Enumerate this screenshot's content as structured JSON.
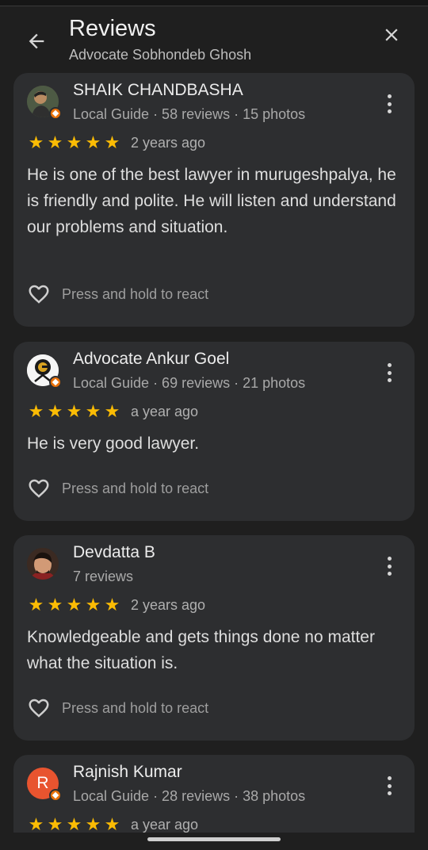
{
  "header": {
    "title": "Reviews",
    "subtitle": "Advocate Sobhondeb Ghosh",
    "back_icon": "arrow-back-icon",
    "close_icon": "close-icon"
  },
  "colors": {
    "star": "#fbbc04",
    "badge": "#e8710a",
    "card": "#2d2e30",
    "background": "#1f1f1f"
  },
  "reviews": [
    {
      "name": "SHAIK CHANDBASHA",
      "meta": "Local Guide · 58 reviews · 15 photos",
      "rating": 5,
      "date": "2 years ago",
      "text": "He is one of the best lawyer in murugeshpalya, he is friendly and polite. He will listen and understand our problems and situation.",
      "react_label": "Press and hold to react"
    },
    {
      "name": "Advocate Ankur Goel",
      "meta": "Local Guide · 69 reviews · 21 photos",
      "rating": 5,
      "date": "a year ago",
      "text": "He is very good lawyer.",
      "react_label": "Press and hold to react"
    },
    {
      "name": "Devdatta B",
      "meta": "7 reviews",
      "rating": 5,
      "date": "2 years ago",
      "text": "Knowledgeable and gets things done no matter what the situation is.",
      "react_label": "Press and hold to react"
    },
    {
      "name": "Rajnish Kumar",
      "meta": "Local Guide · 28 reviews · 38 photos",
      "rating": 5,
      "date": "a year ago",
      "avatar_letter": "R"
    }
  ]
}
